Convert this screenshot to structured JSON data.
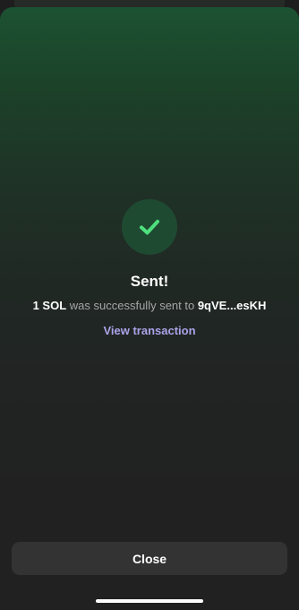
{
  "colors": {
    "accent_green": "#4ee07e",
    "link_purple": "#aba3e8",
    "background": "#212121",
    "button_bg": "#333333"
  },
  "status": {
    "icon": "checkmark-icon",
    "title": "Sent!"
  },
  "message": {
    "amount": "1 SOL",
    "middle_text": " was successfully sent to ",
    "recipient": "9qVE...esKH"
  },
  "link": {
    "label": "View transaction"
  },
  "footer": {
    "close_label": "Close"
  }
}
